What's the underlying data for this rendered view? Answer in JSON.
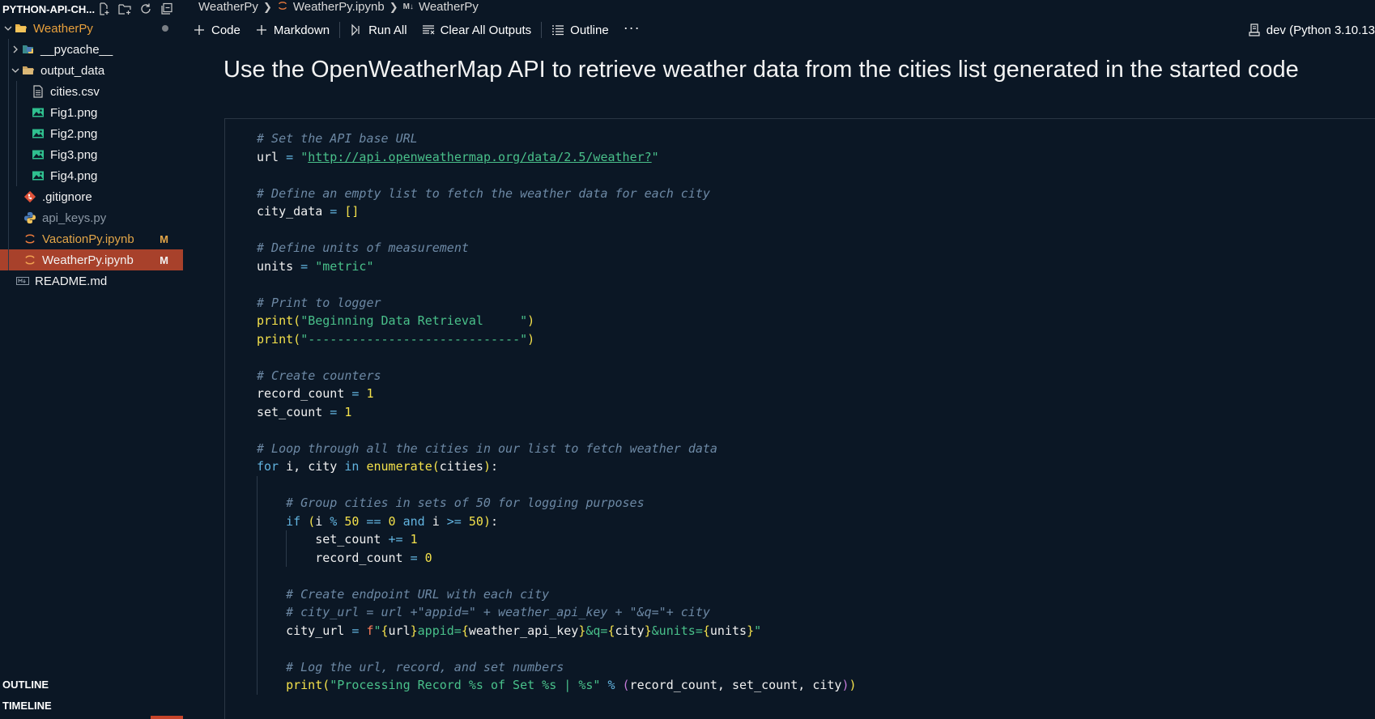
{
  "explorer": {
    "title": "PYTHON-API-CH...",
    "tree": [
      {
        "label": "WeatherPy",
        "type": "folder-open",
        "chevron": "down",
        "color": "orange",
        "dot": true
      },
      {
        "label": "__pycache__",
        "type": "folder",
        "chevron": "right"
      },
      {
        "label": "output_data",
        "type": "folder-open",
        "chevron": "down"
      },
      {
        "label": "cities.csv",
        "type": "csv"
      },
      {
        "label": "Fig1.png",
        "type": "image"
      },
      {
        "label": "Fig2.png",
        "type": "image"
      },
      {
        "label": "Fig3.png",
        "type": "image"
      },
      {
        "label": "Fig4.png",
        "type": "image"
      },
      {
        "label": ".gitignore",
        "type": "git"
      },
      {
        "label": "api_keys.py",
        "type": "python"
      },
      {
        "label": "VacationPy.ipynb",
        "type": "notebook",
        "badge": "M"
      },
      {
        "label": "WeatherPy.ipynb",
        "type": "notebook",
        "badge": "M",
        "selected": true
      },
      {
        "label": "README.md",
        "type": "markdown"
      }
    ],
    "outline_label": "OUTLINE",
    "timeline_label": "TIMELINE"
  },
  "breadcrumb": {
    "folder": "WeatherPy",
    "file": "WeatherPy.ipynb",
    "md_tag": "M↓",
    "section": "WeatherPy"
  },
  "toolbar": {
    "code": "Code",
    "markdown": "Markdown",
    "run_all": "Run All",
    "clear_outputs": "Clear All Outputs",
    "outline": "Outline",
    "more": "···",
    "kernel": "dev (Python 3.10.13"
  },
  "notebook": {
    "heading": "Use the OpenWeatherMap API to retrieve weather data from the cities list generated in the started code"
  },
  "code_lines": [
    {
      "indent": 0,
      "tokens": [
        [
          "com",
          "# Set the API base URL"
        ]
      ]
    },
    {
      "indent": 0,
      "tokens": [
        [
          "id",
          "url"
        ],
        [
          "op",
          " = "
        ],
        [
          "str",
          "\""
        ],
        [
          "url",
          "http://api.openweathermap.org/data/2.5/weather?"
        ],
        [
          "str",
          "\""
        ]
      ]
    },
    {
      "indent": 0,
      "tokens": []
    },
    {
      "indent": 0,
      "tokens": [
        [
          "com",
          "# Define an empty list to fetch the weather data for each city"
        ]
      ]
    },
    {
      "indent": 0,
      "tokens": [
        [
          "id",
          "city_data"
        ],
        [
          "op",
          " = "
        ],
        [
          "paren",
          "[]"
        ]
      ]
    },
    {
      "indent": 0,
      "tokens": []
    },
    {
      "indent": 0,
      "tokens": [
        [
          "com",
          "# Define units of measurement"
        ]
      ]
    },
    {
      "indent": 0,
      "tokens": [
        [
          "id",
          "units"
        ],
        [
          "op",
          " = "
        ],
        [
          "str",
          "\"metric\""
        ]
      ]
    },
    {
      "indent": 0,
      "tokens": []
    },
    {
      "indent": 0,
      "tokens": [
        [
          "com",
          "# Print to logger"
        ]
      ]
    },
    {
      "indent": 0,
      "tokens": [
        [
          "fn",
          "print"
        ],
        [
          "paren",
          "("
        ],
        [
          "str",
          "\"Beginning Data Retrieval     \""
        ],
        [
          "paren",
          ")"
        ]
      ]
    },
    {
      "indent": 0,
      "tokens": [
        [
          "fn",
          "print"
        ],
        [
          "paren",
          "("
        ],
        [
          "str",
          "\"-----------------------------\""
        ],
        [
          "paren",
          ")"
        ]
      ]
    },
    {
      "indent": 0,
      "tokens": []
    },
    {
      "indent": 0,
      "tokens": [
        [
          "com",
          "# Create counters"
        ]
      ]
    },
    {
      "indent": 0,
      "tokens": [
        [
          "id",
          "record_count"
        ],
        [
          "op",
          " = "
        ],
        [
          "num",
          "1"
        ]
      ]
    },
    {
      "indent": 0,
      "tokens": [
        [
          "id",
          "set_count"
        ],
        [
          "op",
          " = "
        ],
        [
          "num",
          "1"
        ]
      ]
    },
    {
      "indent": 0,
      "tokens": []
    },
    {
      "indent": 0,
      "tokens": [
        [
          "com",
          "# Loop through all the cities in our list to fetch weather data"
        ]
      ]
    },
    {
      "indent": 0,
      "tokens": [
        [
          "kw",
          "for"
        ],
        [
          "id",
          " i, city "
        ],
        [
          "kw",
          "in"
        ],
        [
          "id",
          " "
        ],
        [
          "fn",
          "enumerate"
        ],
        [
          "paren",
          "("
        ],
        [
          "id",
          "cities"
        ],
        [
          "paren",
          ")"
        ],
        [
          "id",
          ":"
        ]
      ]
    },
    {
      "indent": 1,
      "tokens": []
    },
    {
      "indent": 1,
      "tokens": [
        [
          "com",
          "# Group cities in sets of 50 for logging purposes"
        ]
      ]
    },
    {
      "indent": 1,
      "tokens": [
        [
          "kw",
          "if"
        ],
        [
          "id",
          " "
        ],
        [
          "paren",
          "("
        ],
        [
          "id",
          "i "
        ],
        [
          "op",
          "%"
        ],
        [
          "id",
          " "
        ],
        [
          "num",
          "50"
        ],
        [
          "op",
          " == "
        ],
        [
          "num",
          "0"
        ],
        [
          "id",
          " "
        ],
        [
          "kw",
          "and"
        ],
        [
          "id",
          " i "
        ],
        [
          "op",
          ">="
        ],
        [
          "id",
          " "
        ],
        [
          "num",
          "50"
        ],
        [
          "paren",
          ")"
        ],
        [
          "id",
          ":"
        ]
      ]
    },
    {
      "indent": 2,
      "tokens": [
        [
          "id",
          "set_count "
        ],
        [
          "op",
          "+="
        ],
        [
          "id",
          " "
        ],
        [
          "num",
          "1"
        ]
      ]
    },
    {
      "indent": 2,
      "tokens": [
        [
          "id",
          "record_count "
        ],
        [
          "op",
          "="
        ],
        [
          "id",
          " "
        ],
        [
          "num",
          "0"
        ]
      ]
    },
    {
      "indent": 1,
      "tokens": []
    },
    {
      "indent": 1,
      "tokens": [
        [
          "com",
          "# Create endpoint URL with each city"
        ]
      ]
    },
    {
      "indent": 1,
      "tokens": [
        [
          "com",
          "# city_url = url +\"appid=\" + weather_api_key + \"&q=\"+ city"
        ]
      ]
    },
    {
      "indent": 1,
      "tokens": [
        [
          "id",
          "city_url "
        ],
        [
          "op",
          "="
        ],
        [
          "id",
          " "
        ],
        [
          "fstr",
          "f"
        ],
        [
          "str",
          "\""
        ],
        [
          "paren",
          "{"
        ],
        [
          "id",
          "url"
        ],
        [
          "paren",
          "}"
        ],
        [
          "str",
          "appid="
        ],
        [
          "paren",
          "{"
        ],
        [
          "id",
          "weather_api_key"
        ],
        [
          "paren",
          "}"
        ],
        [
          "str",
          "&q="
        ],
        [
          "paren",
          "{"
        ],
        [
          "id",
          "city"
        ],
        [
          "paren",
          "}"
        ],
        [
          "str",
          "&units="
        ],
        [
          "paren",
          "{"
        ],
        [
          "id",
          "units"
        ],
        [
          "paren",
          "}"
        ],
        [
          "str",
          "\""
        ]
      ]
    },
    {
      "indent": 1,
      "tokens": []
    },
    {
      "indent": 1,
      "tokens": [
        [
          "com",
          "# Log the url, record, and set numbers"
        ]
      ]
    },
    {
      "indent": 1,
      "tokens": [
        [
          "fn",
          "print"
        ],
        [
          "paren",
          "("
        ],
        [
          "str",
          "\"Processing Record %s of Set %s | %s\""
        ],
        [
          "op",
          " % "
        ],
        [
          "paren2",
          "("
        ],
        [
          "id",
          "record_count, set_count, city"
        ],
        [
          "paren2",
          ")"
        ],
        [
          "paren",
          ")"
        ]
      ]
    }
  ],
  "colors": {
    "background": "#0b1725",
    "selected_row": "#a8412b",
    "accent_orange": "#e8a03c",
    "string": "#49c08a",
    "comment": "#6d89a5",
    "keyword": "#62b4e0",
    "function": "#f4e14b"
  }
}
